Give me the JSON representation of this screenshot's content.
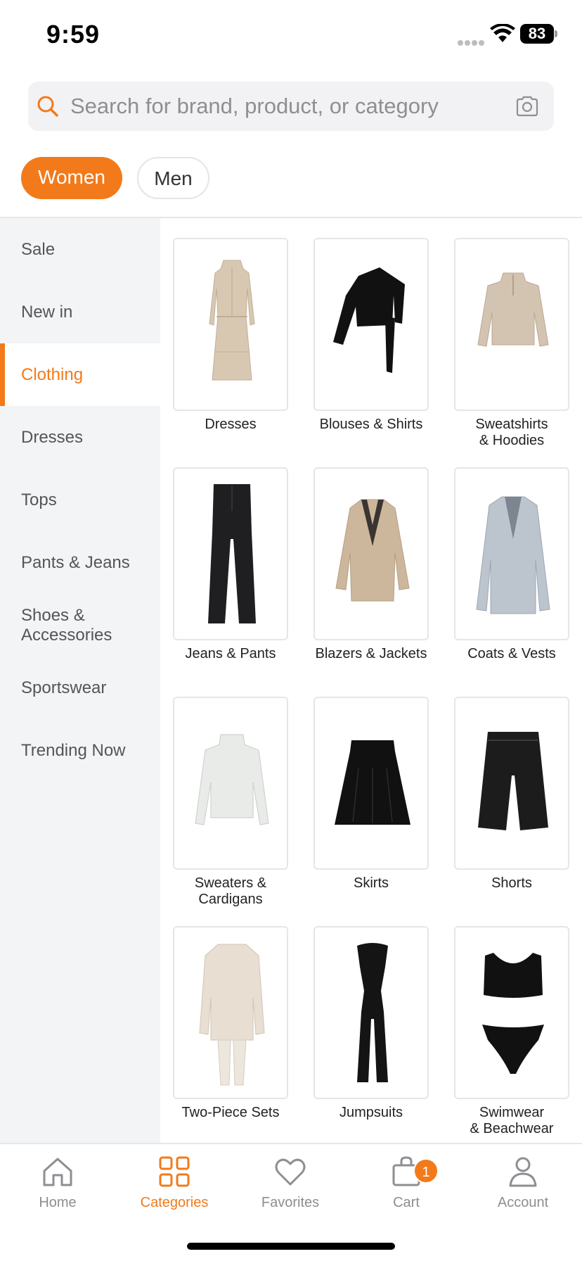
{
  "status_bar": {
    "time": "9:59",
    "battery": "83"
  },
  "search": {
    "placeholder": "Search for brand, product, or category"
  },
  "gender_tabs": [
    {
      "label": "Women",
      "selected": true
    },
    {
      "label": "Men",
      "selected": false
    }
  ],
  "sidebar": {
    "items": [
      {
        "label": "Sale"
      },
      {
        "label": "New in"
      },
      {
        "label": "Clothing",
        "active": true
      },
      {
        "label": "Dresses"
      },
      {
        "label": "Tops"
      },
      {
        "label": "Pants & Jeans"
      },
      {
        "label": "Shoes &\nAccessories"
      },
      {
        "label": "Sportswear"
      },
      {
        "label": "Trending Now"
      }
    ]
  },
  "categories": [
    {
      "label": "Dresses",
      "image": "beige-long-dress"
    },
    {
      "label": "Blouses & Shirts",
      "image": "black-one-shoulder-top"
    },
    {
      "label": "Sweatshirts\n& Hoodies",
      "image": "beige-sweatshirt"
    },
    {
      "label": "Jeans & Pants",
      "image": "black-flare-jeans"
    },
    {
      "label": "Blazers & Jackets",
      "image": "beige-blazer"
    },
    {
      "label": "Coats & Vests",
      "image": "grey-coat"
    },
    {
      "label": "Sweaters &\nCardigans",
      "image": "white-sweater"
    },
    {
      "label": "Skirts",
      "image": "black-skirt"
    },
    {
      "label": "Shorts",
      "image": "black-leather-shorts"
    },
    {
      "label": "Two-Piece Sets",
      "image": "cream-knit-set"
    },
    {
      "label": "Jumpsuits",
      "image": "black-jumpsuit"
    },
    {
      "label": "Swimwear\n& Beachwear",
      "image": "black-bikini"
    }
  ],
  "bottom_nav": {
    "items": [
      {
        "label": "Home",
        "icon": "home-icon"
      },
      {
        "label": "Categories",
        "icon": "grid-icon",
        "active": true
      },
      {
        "label": "Favorites",
        "icon": "heart-icon"
      },
      {
        "label": "Cart",
        "icon": "bag-icon",
        "badge": "1"
      },
      {
        "label": "Account",
        "icon": "user-icon"
      }
    ]
  },
  "colors": {
    "accent": "#f27a1a",
    "sidebar_bg": "#f3f4f6",
    "muted_text": "#8e8e93"
  }
}
